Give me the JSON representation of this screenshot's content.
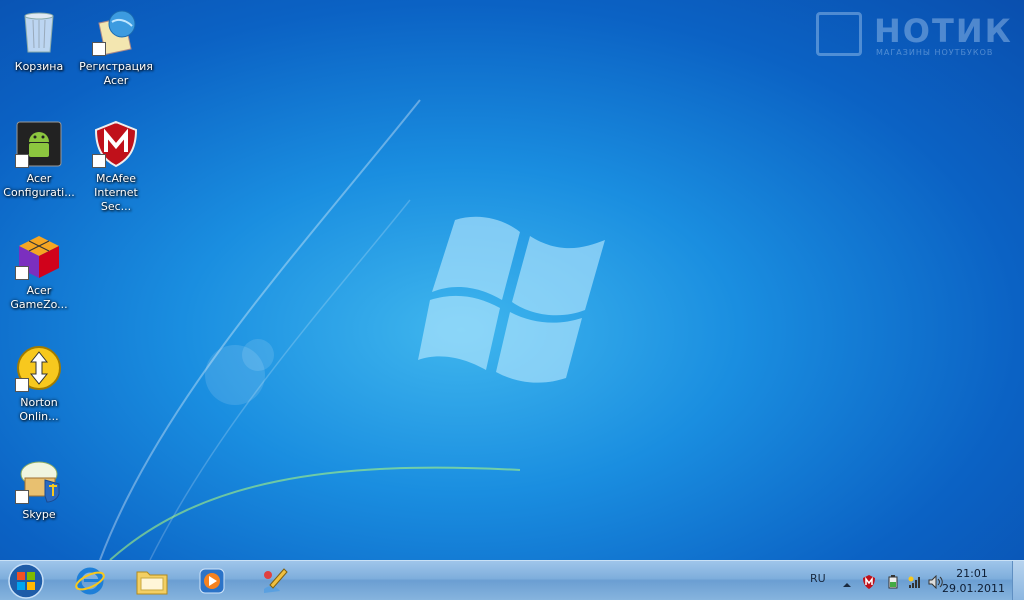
{
  "watermark": {
    "title": "НОТИК",
    "subtitle": "МАГАЗИНЫ НОУТБУКОВ"
  },
  "desktop_icons": [
    {
      "label": "Корзина",
      "icon": "recycle-bin-icon"
    },
    {
      "label": "Регистрация Acer",
      "icon": "registration-globe-icon"
    },
    {
      "label": "Acer Configurati...",
      "icon": "android-config-icon"
    },
    {
      "label": "McAfee Internet Sec...",
      "icon": "mcafee-shield-icon"
    },
    {
      "label": "Acer GameZo...",
      "icon": "gamezone-cube-icon"
    },
    {
      "label": "Norton Onlin...",
      "icon": "norton-backup-icon"
    },
    {
      "label": "Skype",
      "icon": "skype-icon"
    }
  ],
  "taskbar": {
    "pinned": [
      {
        "name": "Internet Explorer",
        "icon": "internet-explorer-icon"
      },
      {
        "name": "Windows Explorer",
        "icon": "folder-icon"
      },
      {
        "name": "Windows Media Player",
        "icon": "media-player-icon"
      },
      {
        "name": "Acer tool",
        "icon": "paint-tool-icon"
      }
    ],
    "tray": {
      "language": "RU",
      "time": "21:01",
      "date": "29.01.2011"
    }
  },
  "colors": {
    "wallpaper_center": "#3fb6ee",
    "wallpaper_edge": "#0a4fae",
    "taskbar": "#7eaedc"
  }
}
